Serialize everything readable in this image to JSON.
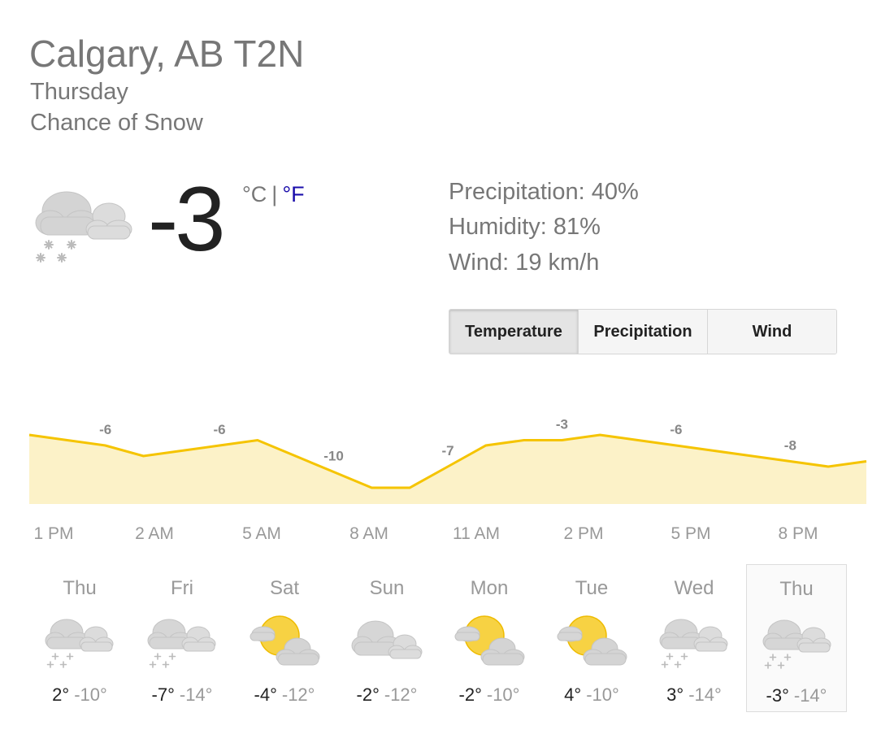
{
  "location": "Calgary, AB T2N",
  "day": "Thursday",
  "condition": "Chance of Snow",
  "current": {
    "temp": "-3",
    "unit_c": "°C",
    "separator": "|",
    "unit_f": "°F",
    "icon": "snow-cloud-icon"
  },
  "stats": {
    "precipitation": "Precipitation: 40%",
    "humidity": "Humidity: 81%",
    "wind": "Wind: 19 km/h"
  },
  "tabs": [
    "Temperature",
    "Precipitation",
    "Wind"
  ],
  "selected_tab": "Temperature",
  "chart_data": {
    "type": "area",
    "series": [
      {
        "values": [
          -5,
          -5.5,
          -6,
          -7,
          -6.5,
          -6,
          -5.5,
          -7,
          -8.5,
          -10,
          -10,
          -8,
          -6,
          -5.5,
          -5.5,
          -5,
          -5.5,
          -6,
          -6.5,
          -7,
          -7.5,
          -8,
          -7.5
        ],
        "labels": [
          "",
          "",
          "-6",
          "",
          "",
          "-6",
          "",
          "",
          "-10",
          "",
          "",
          "-7",
          "",
          "",
          "-3",
          "",
          "",
          "-6",
          "",
          "",
          "-8",
          "",
          ""
        ]
      }
    ],
    "x_ticks": [
      "1 PM",
      "2 AM",
      "5 AM",
      "8 AM",
      "11 AM",
      "2 PM",
      "5 PM",
      "8 PM"
    ],
    "colors": {
      "line": "#f5c400",
      "fill": "#fcf2c8",
      "label": "#888888"
    }
  },
  "forecast": [
    {
      "day": "Thu",
      "icon": "snow-cloud-icon",
      "hi": "2°",
      "lo": "-10°"
    },
    {
      "day": "Fri",
      "icon": "snow-cloud-icon",
      "hi": "-7°",
      "lo": "-14°"
    },
    {
      "day": "Sat",
      "icon": "partly-sunny-icon",
      "hi": "-4°",
      "lo": "-12°"
    },
    {
      "day": "Sun",
      "icon": "cloudy-icon",
      "hi": "-2°",
      "lo": "-12°"
    },
    {
      "day": "Mon",
      "icon": "partly-sunny-icon",
      "hi": "-2°",
      "lo": "-10°"
    },
    {
      "day": "Tue",
      "icon": "partly-sunny-icon",
      "hi": "4°",
      "lo": "-10°"
    },
    {
      "day": "Wed",
      "icon": "snow-cloud-icon",
      "hi": "3°",
      "lo": "-14°"
    },
    {
      "day": "Thu",
      "icon": "snow-cloud-icon",
      "hi": "-3°",
      "lo": "-14°",
      "selected": true
    }
  ]
}
